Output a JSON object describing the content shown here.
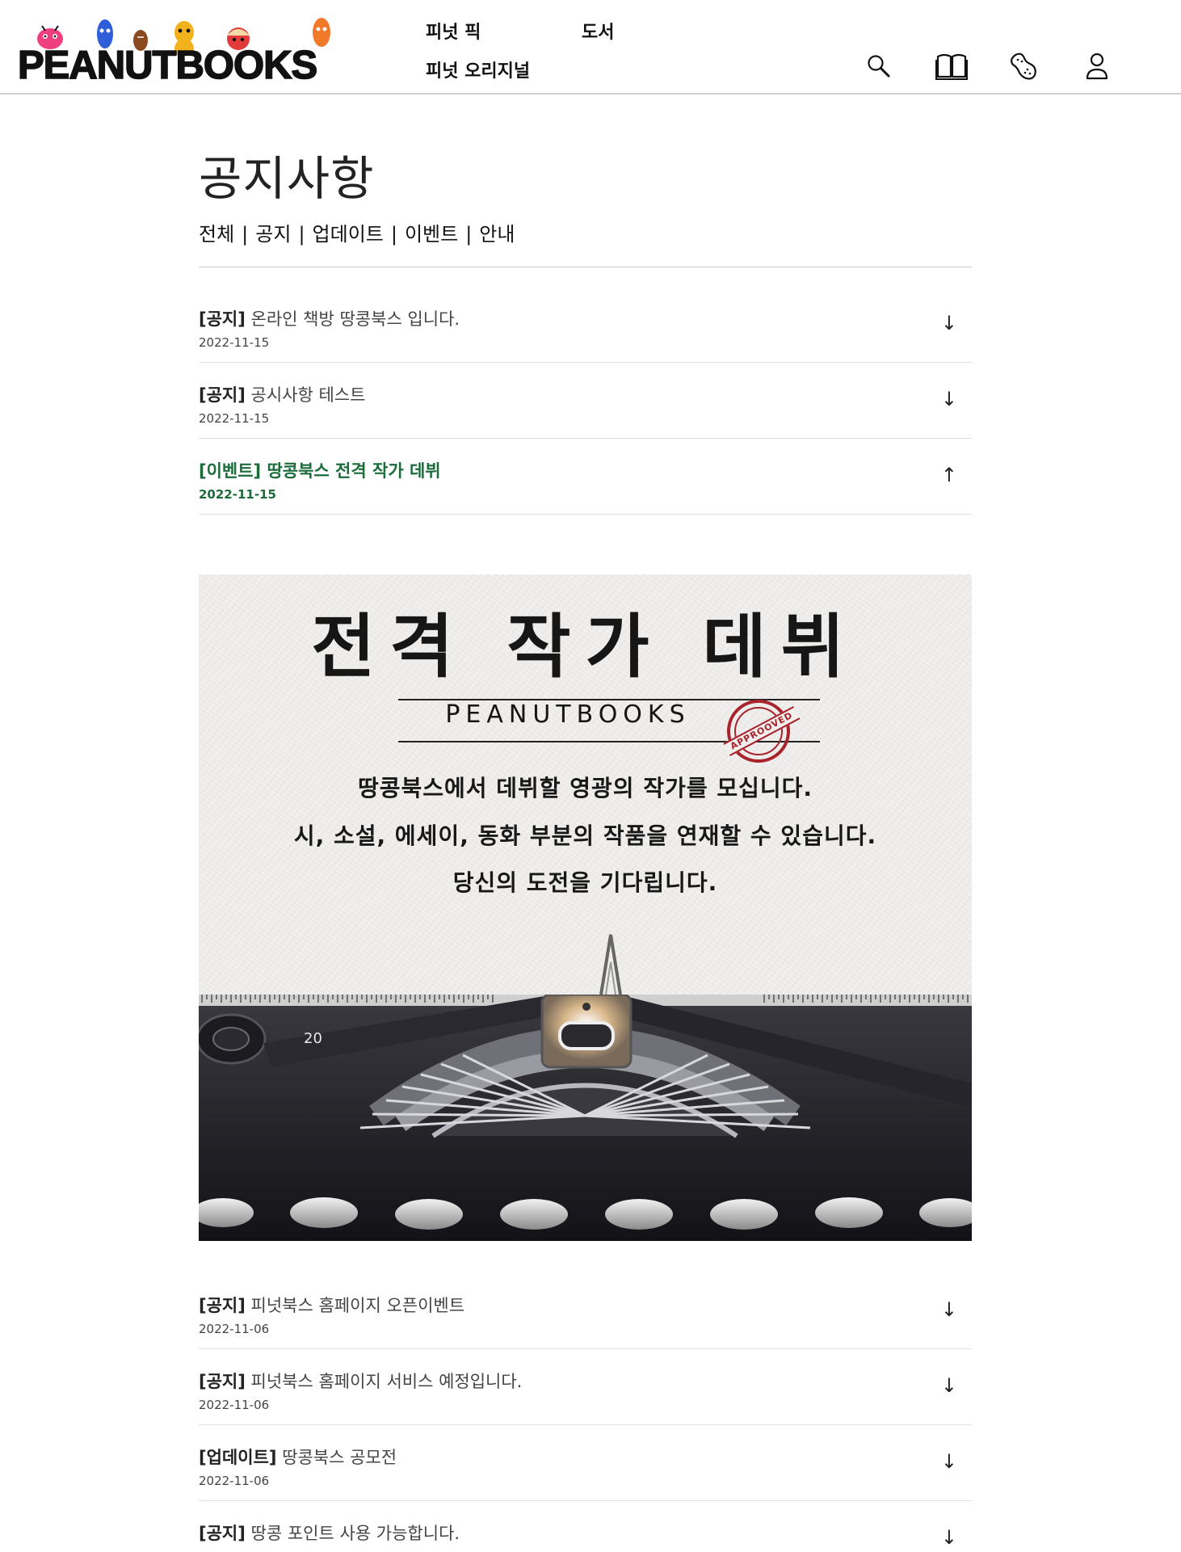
{
  "header": {
    "logo_text": "PEANUTBOOKS",
    "nav": {
      "peanut_pick": "피넛 픽",
      "books": "도서",
      "peanut_original": "피넛 오리지널"
    },
    "icons": [
      "search-icon",
      "book-icon",
      "peanut-icon",
      "user-icon"
    ]
  },
  "page": {
    "title": "공지사항",
    "filters": [
      "전체",
      "공지",
      "업데이트",
      "이벤트",
      "안내"
    ],
    "filter_separator": "|"
  },
  "notices_top": [
    {
      "category": "[공지]",
      "title": "온라인 책방 땅콩북스 입니다.",
      "date": "2022-11-15",
      "arrow": "↓",
      "expanded": false
    },
    {
      "category": "[공지]",
      "title": "공시사항 테스트",
      "date": "2022-11-15",
      "arrow": "↓",
      "expanded": false
    },
    {
      "category": "[이벤트]",
      "title": "땅콩북스 전격 작가 데뷔",
      "date": "2022-11-15",
      "arrow": "↑",
      "expanded": true
    }
  ],
  "banner": {
    "title": "전격 작가 데뷔",
    "brand": "PEANUTBOOKS",
    "stamp": "APPROOVED",
    "lines": [
      "땅콩북스에서 데뷔할 영광의 작가를 모십니다.",
      "시, 소설, 에세이, 동화 부분의 작품을 연재할 수 있습니다.",
      "당신의 도전을 기다립니다."
    ],
    "ruler_number": "20"
  },
  "notices_bottom": [
    {
      "category": "[공지]",
      "title": "피넛북스 홈페이지 오픈이벤트",
      "date": "2022-11-06",
      "arrow": "↓",
      "expanded": false
    },
    {
      "category": "[공지]",
      "title": "피넛북스 홈페이지 서비스 예정입니다.",
      "date": "2022-11-06",
      "arrow": "↓",
      "expanded": false
    },
    {
      "category": "[업데이트]",
      "title": "땅콩북스 공모전",
      "date": "2022-11-06",
      "arrow": "↓",
      "expanded": false
    },
    {
      "category": "[공지]",
      "title": "땅콩 포인트 사용 가능합니다.",
      "date": "2022-11-06",
      "arrow": "↓",
      "expanded": false
    }
  ],
  "colors": {
    "active_notice": "#1c6b3b",
    "stamp": "#a8232b"
  }
}
